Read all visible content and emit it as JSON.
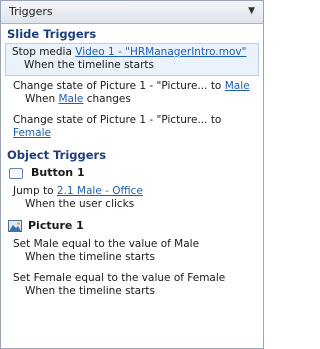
{
  "panel": {
    "title": "Triggers",
    "dropdown_icon": "chevron-down-icon"
  },
  "slide_triggers": {
    "header": "Slide Triggers",
    "items": [
      {
        "prefix": "Stop media ",
        "link": "Video 1 - \"HRManagerIntro.mov\"",
        "condition": "When the timeline starts"
      },
      {
        "prefix": "Change state of Picture 1 - \"Picture... to ",
        "link": "Male",
        "condition_prefix": "When ",
        "condition_link": "Male",
        "condition_suffix": " changes"
      },
      {
        "prefix": "Change state of Picture 1 - \"Picture... to",
        "link": "Female"
      }
    ]
  },
  "object_triggers": {
    "header": "Object Triggers",
    "objects": [
      {
        "name": "Button 1",
        "icon": "button-icon",
        "triggers": [
          {
            "prefix": "Jump to ",
            "link": "2.1 Male - Office",
            "condition": "When the user clicks"
          }
        ]
      },
      {
        "name": "Picture 1",
        "icon": "picture-icon",
        "triggers": [
          {
            "text": "Set Male equal to the value of Male",
            "condition": "When the timeline starts"
          },
          {
            "text": "Set Female equal to the value of Female",
            "condition": "When the timeline starts"
          }
        ]
      }
    ]
  },
  "colors": {
    "link": "#1f5fae",
    "section_header": "#1f3f7a",
    "selected_bg": "#eaf2fb"
  }
}
